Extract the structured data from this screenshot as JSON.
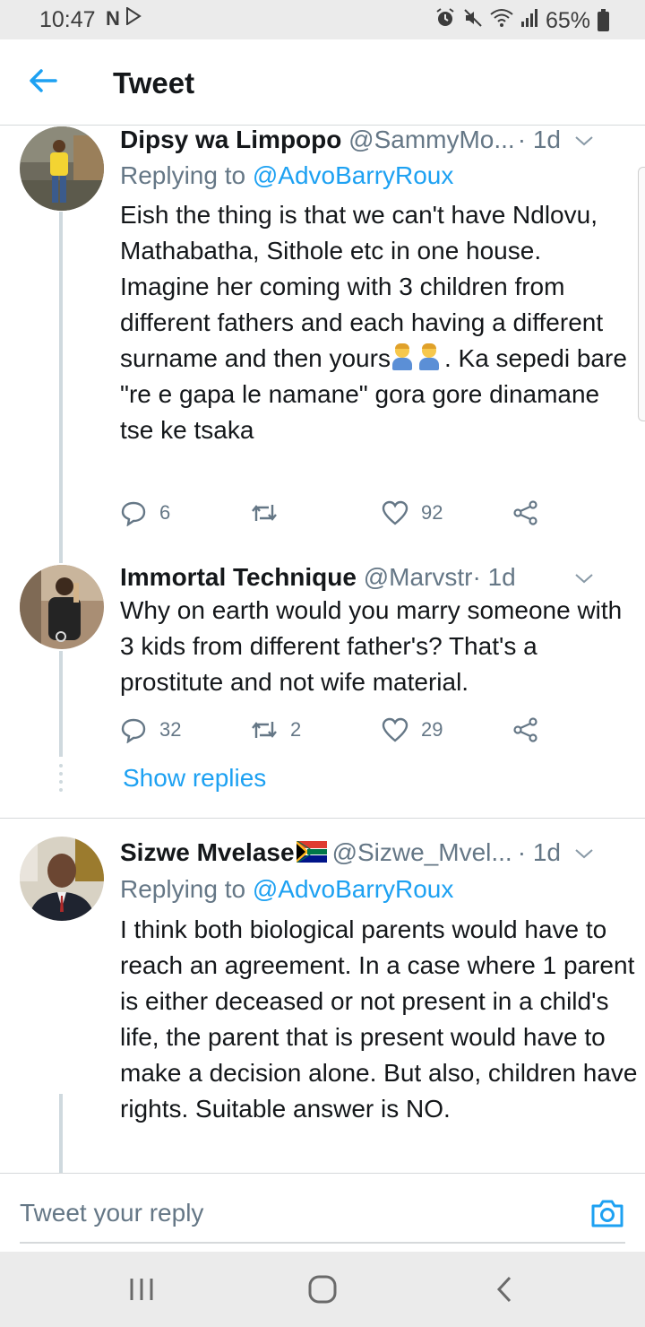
{
  "status_bar": {
    "time": "10:47",
    "left_icons": [
      "netflix-n-icon",
      "play-store-icon"
    ],
    "right_icons": [
      "alarm-icon",
      "mute-icon",
      "wifi-icon",
      "signal-icon"
    ],
    "battery": "65%"
  },
  "header": {
    "title": "Tweet",
    "back_icon": "arrow-left-icon"
  },
  "tweets": [
    {
      "name": "Dipsy wa Limpopo",
      "handle": "@SammyMo...",
      "time": "· 1d",
      "replying_prefix": "Replying to ",
      "replying_to": "@AdvoBarryRoux",
      "text_before_emoji": "Eish the thing is that we can't have Ndlovu, Mathabatha, Sithole etc in one house.  Imagine her coming with 3 children from different fathers and each having a different surname and then yours",
      "emoji_name": "man-shrugging-emoji",
      "text_after_emoji": ". Ka sepedi bare \"re e gapa le namane\" gora gore dinamane tse ke tsaka",
      "replies": "6",
      "retweets": "",
      "likes": "92"
    },
    {
      "name": "Immortal Technique",
      "handle": "@Marvstr",
      "time": "· 1d",
      "text": "Why on earth would you marry someone with 3 kids from different father's? That's a prostitute and not wife material.",
      "replies": "32",
      "retweets": "2",
      "likes": "29"
    },
    {
      "name": "Sizwe Mvelase",
      "flag": "south-africa-flag-emoji",
      "handle": "@Sizwe_Mvel...",
      "time": "· 1d",
      "replying_prefix": "Replying to ",
      "replying_to": "@AdvoBarryRoux",
      "text": "I think both biological parents would have to reach an agreement. In a case where 1 parent is either deceased or not present in a child's life, the parent that is present would have to make a decision alone. But also, children have rights. Suitable answer  is NO."
    }
  ],
  "show_replies": "Show replies",
  "composer": {
    "placeholder": "Tweet your reply",
    "camera_icon": "camera-icon"
  },
  "navbar": {
    "icons": [
      "recent-apps-icon",
      "home-icon",
      "back-icon"
    ]
  },
  "colors": {
    "accent": "#1da1f2",
    "secondary_text": "#657786",
    "primary_text": "#14171a",
    "divider": "#d6d9db"
  }
}
